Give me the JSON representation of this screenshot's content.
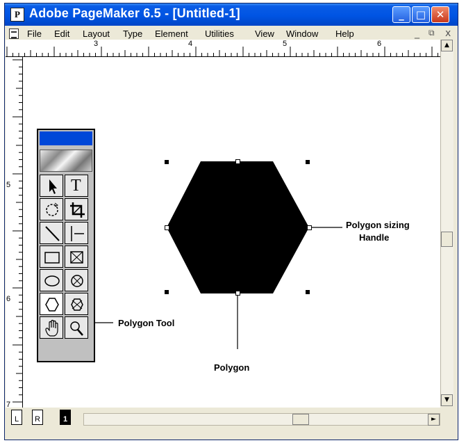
{
  "window": {
    "title": "Adobe PageMaker 6.5 - [Untitled-1]",
    "app_icon_letter": "P",
    "minimize_glyph": "_",
    "maximize_glyph": "□",
    "close_glyph": "✕"
  },
  "menubar": {
    "items": [
      "File",
      "Edit",
      "Layout",
      "Type",
      "Element",
      "Utilities",
      "View",
      "Window",
      "Help"
    ],
    "doc_minimize": "_",
    "doc_restore": "ð",
    "doc_close": "x"
  },
  "rulers": {
    "top_labels": [
      "3",
      "4",
      "5",
      "6"
    ],
    "left_labels": [
      "5",
      "6",
      "7"
    ]
  },
  "pages": {
    "left": "L",
    "right": "R",
    "current": "1"
  },
  "scroll": {
    "up": "▲",
    "down": "▼",
    "left": "◄",
    "right": "►"
  },
  "annotations": {
    "sizing_handle_line1": "Polygon sizing",
    "sizing_handle_line2": "Handle",
    "polygon_tool": "Polygon Tool",
    "polygon": "Polygon"
  },
  "toolbox": {
    "text_tool_glyph": "T",
    "tools": [
      "pointer-tool",
      "text-tool",
      "rotate-tool",
      "crop-tool",
      "line-tool",
      "constrained-line-tool",
      "rectangle-tool",
      "rectangle-frame-tool",
      "ellipse-tool",
      "ellipse-frame-tool",
      "polygon-tool",
      "polygon-frame-tool",
      "hand-tool",
      "zoom-tool"
    ]
  },
  "colors": {
    "titlebar": "#0054e3",
    "toolbox_title": "#0047d8",
    "polygon_fill": "#000000"
  }
}
